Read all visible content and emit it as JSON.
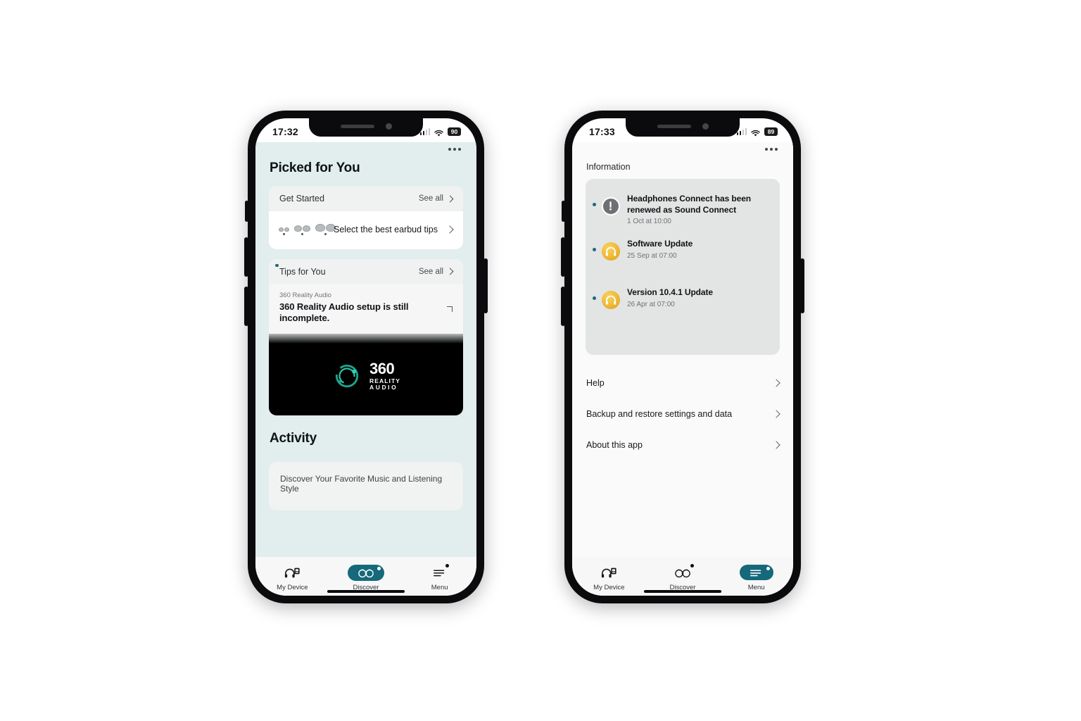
{
  "colors": {
    "accent_teal": "#15697a",
    "teal_bg": "#e2eded",
    "gold": "#edb430",
    "banner_bg": "#000000"
  },
  "phone_left": {
    "status": {
      "clock": "17:32",
      "battery": "90",
      "wifi_icon": "wifi-icon",
      "cellular_icon": "cellular-bars-icon"
    },
    "overflow_menu_icon": "more-options-icon",
    "page_title": "Picked for You",
    "get_started": {
      "title": "Get Started",
      "see_all": "See all",
      "row_label": "Select the best earbud tips",
      "row_icon": "earbud-tips-icon"
    },
    "tips": {
      "title": "Tips for You",
      "see_all": "See all",
      "kicker": "360 Reality Audio",
      "headline": "360 Reality Audio setup is still incomplete.",
      "banner": {
        "logo_number": "360",
        "logo_line1": "REALITY",
        "logo_line2": "AUDIO",
        "logo_icon": "360-reality-audio-logo"
      }
    },
    "activity": {
      "title": "Activity",
      "card_text": "Discover Your Favorite Music and Listening Style"
    },
    "tabs": [
      {
        "label": "My Device",
        "icon": "headphones-device-icon",
        "active": false,
        "badge": false
      },
      {
        "label": "Discover",
        "icon": "binoculars-icon",
        "active": true,
        "badge": true
      },
      {
        "label": "Menu",
        "icon": "hamburger-menu-icon",
        "active": false,
        "badge": true
      }
    ]
  },
  "phone_right": {
    "status": {
      "clock": "17:33",
      "battery": "89",
      "wifi_icon": "wifi-icon",
      "cellular_icon": "cellular-bars-icon"
    },
    "overflow_menu_icon": "more-options-icon",
    "info_label": "Information",
    "notifications": [
      {
        "title": "Headphones Connect has been renewed as Sound Connect",
        "date": "1 Oct at 10:00",
        "icon": "alert-exclamation-icon",
        "unread": true
      },
      {
        "title": "Software Update",
        "date": "25 Sep at 07:00",
        "icon": "headphones-gold-icon",
        "unread": true
      },
      {
        "title": "Version 10.4.1 Update",
        "date": "26 Apr at 07:00",
        "icon": "headphones-gold-icon",
        "unread": true
      }
    ],
    "menu_items": [
      {
        "label": "Help"
      },
      {
        "label": "Backup and restore settings and data"
      },
      {
        "label": "About this app"
      }
    ],
    "tabs": [
      {
        "label": "My Device",
        "icon": "headphones-device-icon",
        "active": false,
        "badge": false
      },
      {
        "label": "Discover",
        "icon": "binoculars-icon",
        "active": false,
        "badge": true
      },
      {
        "label": "Menu",
        "icon": "hamburger-menu-icon",
        "active": true,
        "badge": true
      }
    ]
  }
}
